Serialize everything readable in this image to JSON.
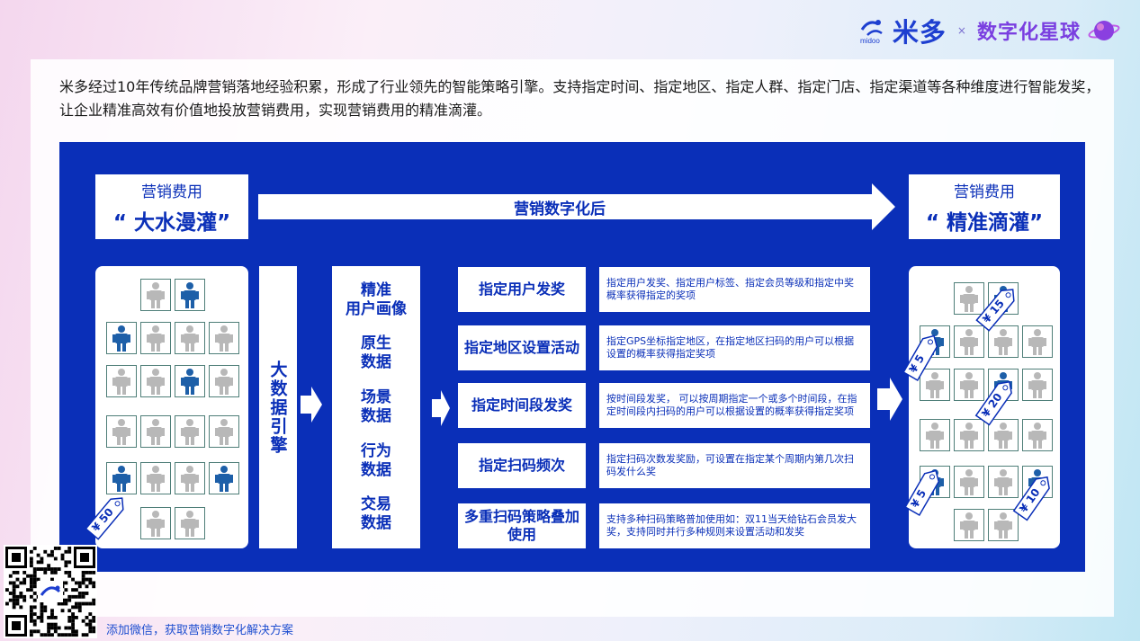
{
  "brand": {
    "logo_name": "midoo",
    "logo_word": "米多",
    "separator": "×",
    "partner": "数字化星球"
  },
  "intro_text": "米多经过10年传统品牌营销落地经验积累，形成了行业领先的智能策略引擎。支持指定时间、指定地区、指定人群、指定门店、指定渠道等各种维度进行智能发奖，让企业精准高效有价值地投放营销费用，实现营销费用的精准滴灌。",
  "before": {
    "caption_small": "营销费用",
    "caption_big": "“ 大水漫灌”"
  },
  "after": {
    "caption_small": "营销费用",
    "caption_big": "“ 精准滴灌”"
  },
  "transition_label": "营销数字化后",
  "engine_label": "大数据引擎",
  "data_sources": [
    "精准\n用户画像",
    "原生\n数据",
    "场景\n数据",
    "行为\n数据",
    "交易\n数据"
  ],
  "features": [
    {
      "title": "指定用户发奖",
      "desc": "指定用户发奖、指定用户标签、指定会员等级和指定中奖概率获得指定的奖项"
    },
    {
      "title": "指定地区设置活动",
      "desc": "指定GPS坐标指定地区，在指定地区扫码的用户可以根据设置的概率获得指定奖项"
    },
    {
      "title": "指定时间段发奖",
      "desc": "按时间段发奖， 可以按周期指定一个或多个时间段，在指定时间段内扫码的用户可以根据设置的概率获得指定奖项"
    },
    {
      "title": "指定扫码频次",
      "desc": "指定扫码次数发奖励，可设置在指定某个周期内第几次扫码发什么奖"
    },
    {
      "title": "多重扫码策略叠加使用",
      "desc": "支持多种扫码策略普加使用如：双11当天给钻石会员发大奖，支持同时并行多种规则来设置活动和发奖"
    }
  ],
  "tags": {
    "left": "¥ 50",
    "right": [
      "¥ 15",
      "¥ 5",
      "¥ 20",
      "¥ 5",
      "¥ 10"
    ]
  },
  "colors": {
    "accent": "#0a2fb8",
    "person_gray": "#b8b8b8",
    "person_blue": "#1d5fa8"
  },
  "footer_text": "添加微信，获取营销数字化解决方案"
}
